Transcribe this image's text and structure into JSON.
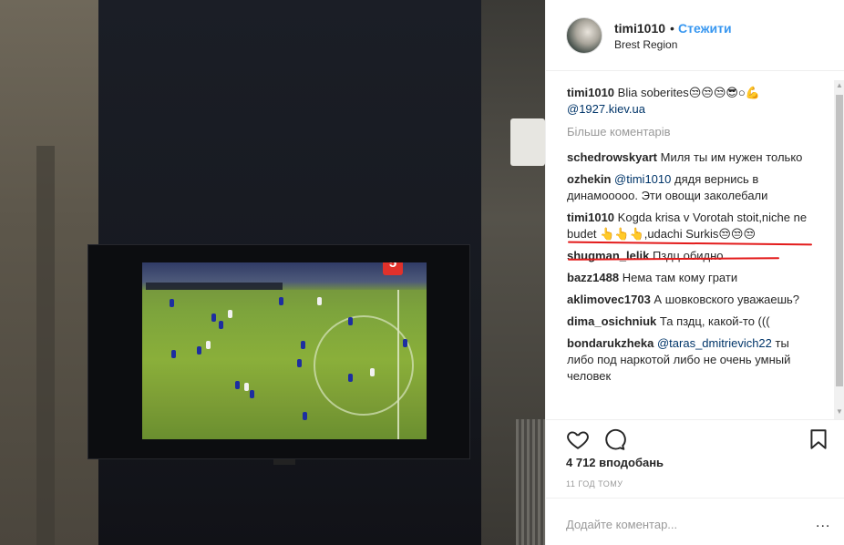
{
  "header": {
    "username": "timi1010",
    "separator": "•",
    "follow_label": "Стежити",
    "location": "Brest Region"
  },
  "caption": {
    "username": "timi1010",
    "text": "Blia soberites😒😒😒😎○💪",
    "mention": "@1927.kiev.ua"
  },
  "load_more_label": "Більше коментарів",
  "comments": [
    {
      "username": "schedrowskyart",
      "mention": "",
      "text": "Миля ты им нужен только"
    },
    {
      "username": "ozhekin",
      "mention": "@timi1010",
      "text": "дядя вернись в динамооооо. Эти овощи заколебали"
    },
    {
      "username": "timi1010",
      "mention": "",
      "text": "Kogda krisa v Vorotah stoit,niche ne budet 👆👆👆,udachi Surkis😒😒😒"
    },
    {
      "username": "shugman_lelik",
      "mention": "",
      "text": "Пздц обидно"
    },
    {
      "username": "bazz1488",
      "mention": "",
      "text": "Нема там кому грати"
    },
    {
      "username": "aklimovec1703",
      "mention": "",
      "text": "А шовковского уважаешь?"
    },
    {
      "username": "dima_osichniuk",
      "mention": "",
      "text": "Та пздц, какой-то ((("
    },
    {
      "username": "bondarukzheka",
      "mention": "@taras_dmitrievich22",
      "text": "ты либо под наркотой либо не очень умный человек"
    }
  ],
  "likes": "4 712 вподобань",
  "timestamp": "11 ГОД ТОМУ",
  "add_comment": {
    "placeholder": "Додайте коментар..."
  },
  "more_options": "...",
  "photo": {
    "channel_logo": "5"
  },
  "icons": {
    "like": "heart-icon",
    "comment": "comment-bubble-icon",
    "save": "bookmark-icon"
  },
  "colors": {
    "link": "#3897f0",
    "mention": "#003569",
    "muted": "#999999",
    "annotation": "#e31b1b"
  }
}
